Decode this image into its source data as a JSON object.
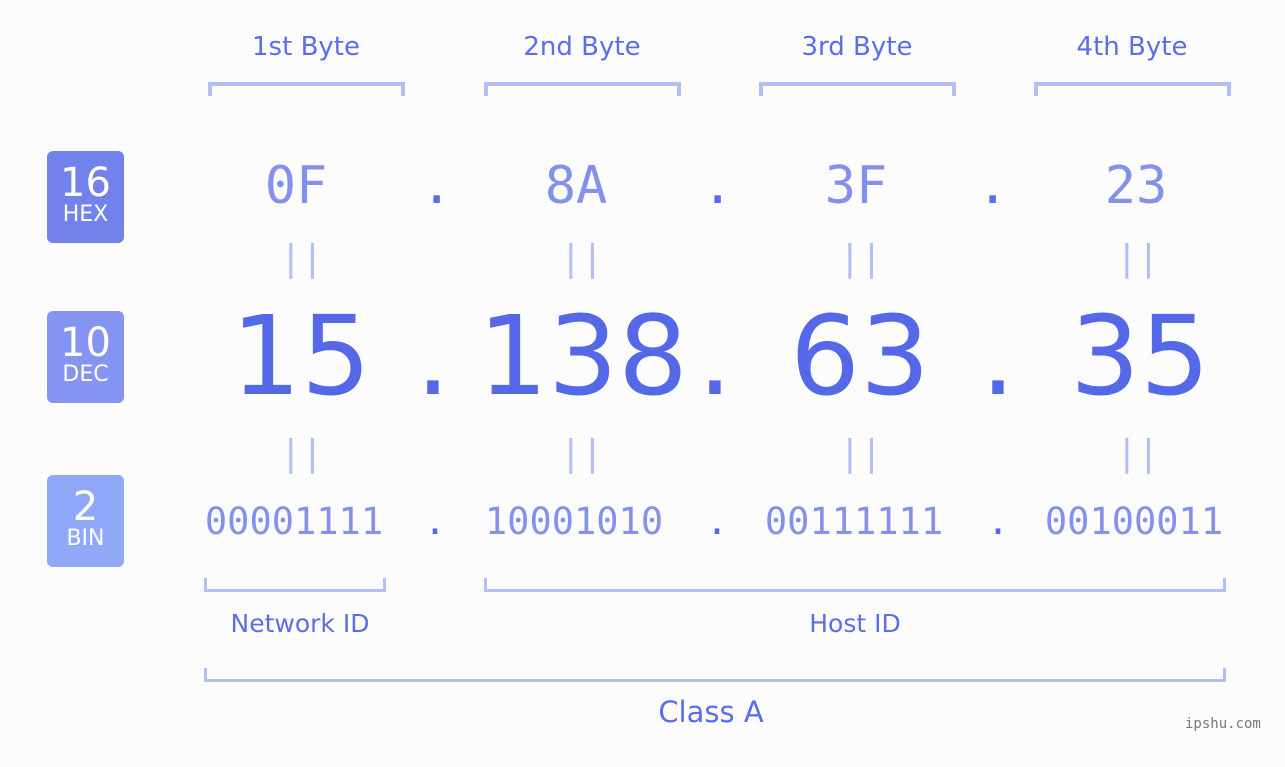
{
  "byte_headers": [
    "1st Byte",
    "2nd Byte",
    "3rd Byte",
    "4th Byte"
  ],
  "badges": {
    "hex": {
      "base": "16",
      "label": "HEX",
      "color": "#7382ea"
    },
    "dec": {
      "base": "10",
      "label": "DEC",
      "color": "#8494f0"
    },
    "bin": {
      "base": "2",
      "label": "BIN",
      "color": "#8fa8f8"
    }
  },
  "hex_values": [
    "0F",
    "8A",
    "3F",
    "23"
  ],
  "dec_values": [
    "15",
    "138",
    "63",
    "35"
  ],
  "bin_values": [
    "00001111",
    "10001010",
    "00111111",
    "00100011"
  ],
  "separator": ".",
  "equals_sign": "||",
  "network_id_label": "Network ID",
  "host_id_label": "Host ID",
  "class_label": "Class A",
  "watermark": "ipshu.com"
}
